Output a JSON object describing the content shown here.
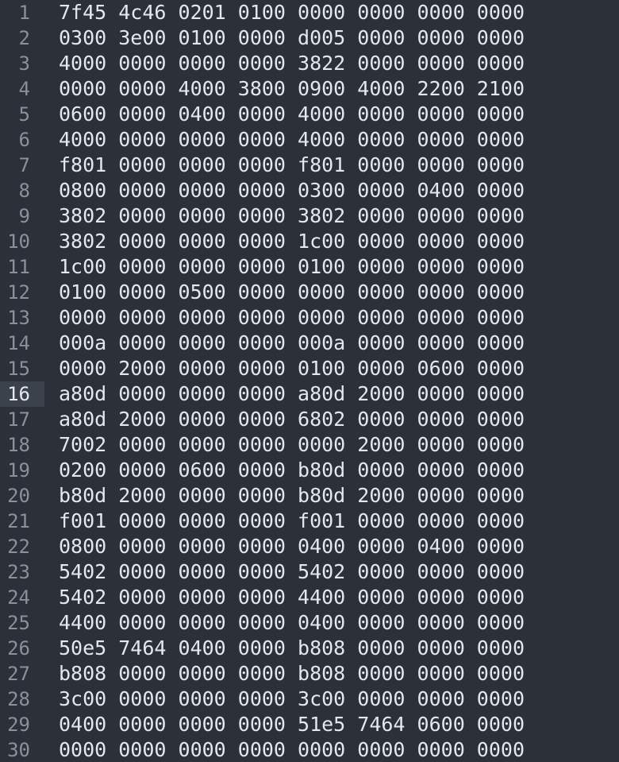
{
  "editor": {
    "current_line": 16,
    "lines": [
      {
        "num": "1",
        "text": "7f45 4c46 0201 0100 0000 0000 0000 0000"
      },
      {
        "num": "2",
        "text": "0300 3e00 0100 0000 d005 0000 0000 0000"
      },
      {
        "num": "3",
        "text": "4000 0000 0000 0000 3822 0000 0000 0000"
      },
      {
        "num": "4",
        "text": "0000 0000 4000 3800 0900 4000 2200 2100"
      },
      {
        "num": "5",
        "text": "0600 0000 0400 0000 4000 0000 0000 0000"
      },
      {
        "num": "6",
        "text": "4000 0000 0000 0000 4000 0000 0000 0000"
      },
      {
        "num": "7",
        "text": "f801 0000 0000 0000 f801 0000 0000 0000"
      },
      {
        "num": "8",
        "text": "0800 0000 0000 0000 0300 0000 0400 0000"
      },
      {
        "num": "9",
        "text": "3802 0000 0000 0000 3802 0000 0000 0000"
      },
      {
        "num": "10",
        "text": "3802 0000 0000 0000 1c00 0000 0000 0000"
      },
      {
        "num": "11",
        "text": "1c00 0000 0000 0000 0100 0000 0000 0000"
      },
      {
        "num": "12",
        "text": "0100 0000 0500 0000 0000 0000 0000 0000"
      },
      {
        "num": "13",
        "text": "0000 0000 0000 0000 0000 0000 0000 0000"
      },
      {
        "num": "14",
        "text": "000a 0000 0000 0000 000a 0000 0000 0000"
      },
      {
        "num": "15",
        "text": "0000 2000 0000 0000 0100 0000 0600 0000"
      },
      {
        "num": "16",
        "text": "a80d 0000 0000 0000 a80d 2000 0000 0000"
      },
      {
        "num": "17",
        "text": "a80d 2000 0000 0000 6802 0000 0000 0000"
      },
      {
        "num": "18",
        "text": "7002 0000 0000 0000 0000 2000 0000 0000"
      },
      {
        "num": "19",
        "text": "0200 0000 0600 0000 b80d 0000 0000 0000"
      },
      {
        "num": "20",
        "text": "b80d 2000 0000 0000 b80d 2000 0000 0000"
      },
      {
        "num": "21",
        "text": "f001 0000 0000 0000 f001 0000 0000 0000"
      },
      {
        "num": "22",
        "text": "0800 0000 0000 0000 0400 0000 0400 0000"
      },
      {
        "num": "23",
        "text": "5402 0000 0000 0000 5402 0000 0000 0000"
      },
      {
        "num": "24",
        "text": "5402 0000 0000 0000 4400 0000 0000 0000"
      },
      {
        "num": "25",
        "text": "4400 0000 0000 0000 0400 0000 0000 0000"
      },
      {
        "num": "26",
        "text": "50e5 7464 0400 0000 b808 0000 0000 0000"
      },
      {
        "num": "27",
        "text": "b808 0000 0000 0000 b808 0000 0000 0000"
      },
      {
        "num": "28",
        "text": "3c00 0000 0000 0000 3c00 0000 0000 0000"
      },
      {
        "num": "29",
        "text": "0400 0000 0000 0000 51e5 7464 0600 0000"
      },
      {
        "num": "30",
        "text": "0000 0000 0000 0000 0000 0000 0000 0000"
      }
    ]
  }
}
